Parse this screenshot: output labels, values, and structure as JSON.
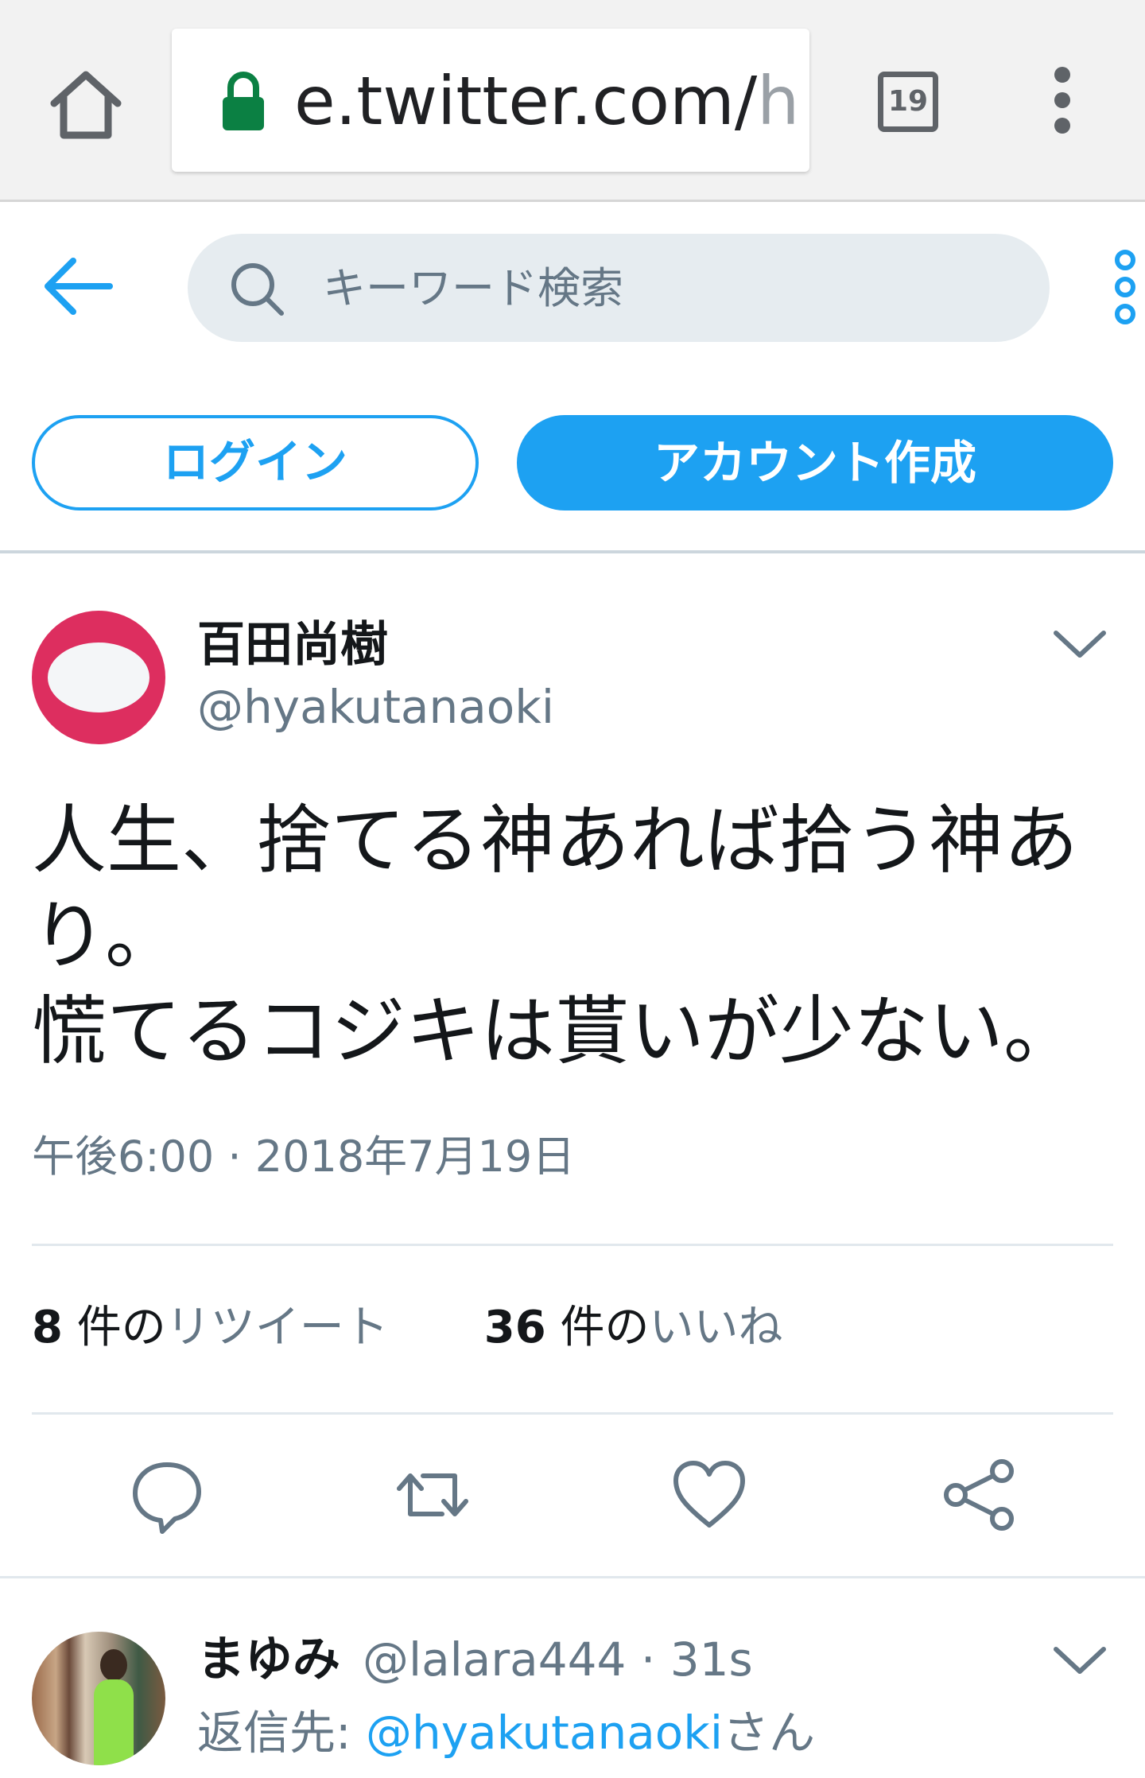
{
  "browser": {
    "url_main": "e.twitter.com/",
    "url_faded": "h",
    "tab_count": "19"
  },
  "header": {
    "search_placeholder": "キーワード検索"
  },
  "auth": {
    "login_label": "ログイン",
    "signup_label": "アカウント作成"
  },
  "tweet": {
    "author_name": "百田尚樹",
    "author_handle": "@hyakutanaoki",
    "text": "人生、捨てる神あれば拾う神あ\nり。\n慌てるコジキは貰いが少ない。",
    "timestamp": "午後6:00 · 2018年7月19日",
    "retweets": {
      "count": "8",
      "unit": " 件の",
      "label": "リツイート"
    },
    "likes": {
      "count": "36",
      "unit": " 件の",
      "label": "いいね"
    }
  },
  "reply": {
    "author_name": "まゆみ",
    "handle_time": "@lalara444 · 31s",
    "reply_prefix": "返信先: ",
    "reply_mention": "@hyakutanaoki",
    "reply_suffix": "さん"
  },
  "colors": {
    "accent": "#1da1f2",
    "muted": "#657786",
    "avatar_red": "#dd2e5f"
  },
  "icons": [
    "home-icon",
    "lock-icon",
    "tabs-icon",
    "overflow-menu-icon",
    "back-arrow-icon",
    "search-icon",
    "more-icon",
    "chevron-down-icon",
    "reply-icon",
    "retweet-icon",
    "like-icon",
    "share-icon"
  ]
}
